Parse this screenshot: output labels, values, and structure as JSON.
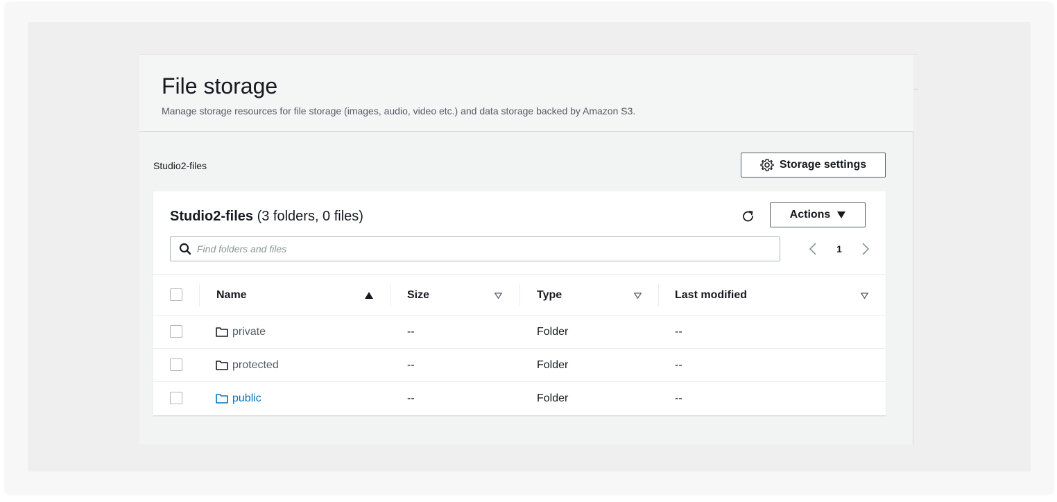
{
  "header": {
    "title": "File storage",
    "subtitle": "Manage storage resources for file storage (images, audio, video etc.) and data storage backed by Amazon S3."
  },
  "breadcrumb": "Studio2-files",
  "toolbar": {
    "storage_settings_label": "Storage settings",
    "actions_label": "Actions"
  },
  "card": {
    "bucket_name": "Studio2-files",
    "counts": " (3 folders, 0 files)",
    "search_placeholder": "Find folders and files",
    "page": "1"
  },
  "table": {
    "columns": [
      "Name",
      "Size",
      "Type",
      "Last modified"
    ],
    "rows": [
      {
        "name": "private",
        "size": "--",
        "type": "Folder",
        "modified": "--"
      },
      {
        "name": "protected",
        "size": "--",
        "type": "Folder",
        "modified": "--"
      },
      {
        "name": "public",
        "size": "--",
        "type": "Folder",
        "modified": "--"
      }
    ]
  },
  "colors": {
    "link": "#0073bb",
    "text": "#16191f",
    "muted": "#545b64",
    "border": "#aab7b8"
  },
  "icons": [
    "gear-icon",
    "refresh-icon",
    "caret-down-icon",
    "search-icon",
    "chevron-left-icon",
    "chevron-right-icon",
    "sort-ascending-icon",
    "sort-icon",
    "folder-icon"
  ]
}
